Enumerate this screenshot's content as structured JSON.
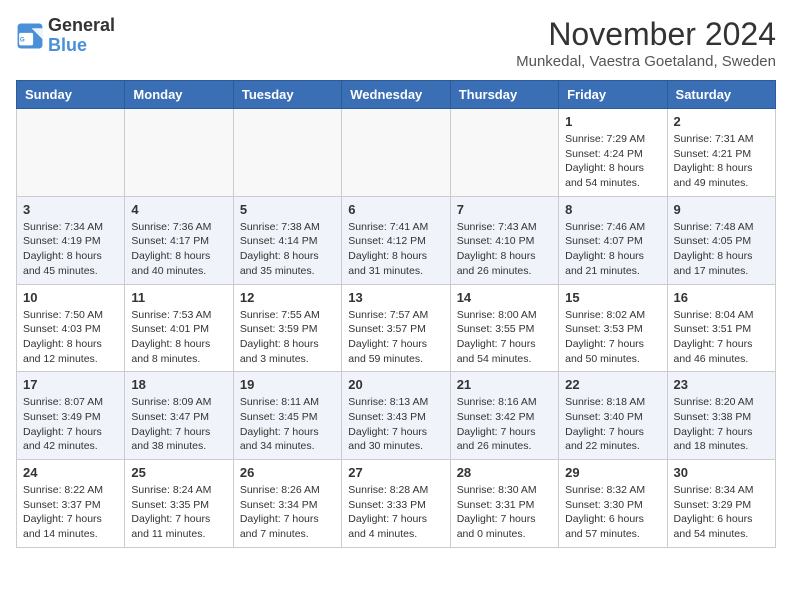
{
  "logo": {
    "line1": "General",
    "line2": "Blue"
  },
  "title": "November 2024",
  "location": "Munkedal, Vaestra Goetaland, Sweden",
  "headers": [
    "Sunday",
    "Monday",
    "Tuesday",
    "Wednesday",
    "Thursday",
    "Friday",
    "Saturday"
  ],
  "weeks": [
    [
      {
        "day": "",
        "content": ""
      },
      {
        "day": "",
        "content": ""
      },
      {
        "day": "",
        "content": ""
      },
      {
        "day": "",
        "content": ""
      },
      {
        "day": "",
        "content": ""
      },
      {
        "day": "1",
        "content": "Sunrise: 7:29 AM\nSunset: 4:24 PM\nDaylight: 8 hours and 54 minutes."
      },
      {
        "day": "2",
        "content": "Sunrise: 7:31 AM\nSunset: 4:21 PM\nDaylight: 8 hours and 49 minutes."
      }
    ],
    [
      {
        "day": "3",
        "content": "Sunrise: 7:34 AM\nSunset: 4:19 PM\nDaylight: 8 hours and 45 minutes."
      },
      {
        "day": "4",
        "content": "Sunrise: 7:36 AM\nSunset: 4:17 PM\nDaylight: 8 hours and 40 minutes."
      },
      {
        "day": "5",
        "content": "Sunrise: 7:38 AM\nSunset: 4:14 PM\nDaylight: 8 hours and 35 minutes."
      },
      {
        "day": "6",
        "content": "Sunrise: 7:41 AM\nSunset: 4:12 PM\nDaylight: 8 hours and 31 minutes."
      },
      {
        "day": "7",
        "content": "Sunrise: 7:43 AM\nSunset: 4:10 PM\nDaylight: 8 hours and 26 minutes."
      },
      {
        "day": "8",
        "content": "Sunrise: 7:46 AM\nSunset: 4:07 PM\nDaylight: 8 hours and 21 minutes."
      },
      {
        "day": "9",
        "content": "Sunrise: 7:48 AM\nSunset: 4:05 PM\nDaylight: 8 hours and 17 minutes."
      }
    ],
    [
      {
        "day": "10",
        "content": "Sunrise: 7:50 AM\nSunset: 4:03 PM\nDaylight: 8 hours and 12 minutes."
      },
      {
        "day": "11",
        "content": "Sunrise: 7:53 AM\nSunset: 4:01 PM\nDaylight: 8 hours and 8 minutes."
      },
      {
        "day": "12",
        "content": "Sunrise: 7:55 AM\nSunset: 3:59 PM\nDaylight: 8 hours and 3 minutes."
      },
      {
        "day": "13",
        "content": "Sunrise: 7:57 AM\nSunset: 3:57 PM\nDaylight: 7 hours and 59 minutes."
      },
      {
        "day": "14",
        "content": "Sunrise: 8:00 AM\nSunset: 3:55 PM\nDaylight: 7 hours and 54 minutes."
      },
      {
        "day": "15",
        "content": "Sunrise: 8:02 AM\nSunset: 3:53 PM\nDaylight: 7 hours and 50 minutes."
      },
      {
        "day": "16",
        "content": "Sunrise: 8:04 AM\nSunset: 3:51 PM\nDaylight: 7 hours and 46 minutes."
      }
    ],
    [
      {
        "day": "17",
        "content": "Sunrise: 8:07 AM\nSunset: 3:49 PM\nDaylight: 7 hours and 42 minutes."
      },
      {
        "day": "18",
        "content": "Sunrise: 8:09 AM\nSunset: 3:47 PM\nDaylight: 7 hours and 38 minutes."
      },
      {
        "day": "19",
        "content": "Sunrise: 8:11 AM\nSunset: 3:45 PM\nDaylight: 7 hours and 34 minutes."
      },
      {
        "day": "20",
        "content": "Sunrise: 8:13 AM\nSunset: 3:43 PM\nDaylight: 7 hours and 30 minutes."
      },
      {
        "day": "21",
        "content": "Sunrise: 8:16 AM\nSunset: 3:42 PM\nDaylight: 7 hours and 26 minutes."
      },
      {
        "day": "22",
        "content": "Sunrise: 8:18 AM\nSunset: 3:40 PM\nDaylight: 7 hours and 22 minutes."
      },
      {
        "day": "23",
        "content": "Sunrise: 8:20 AM\nSunset: 3:38 PM\nDaylight: 7 hours and 18 minutes."
      }
    ],
    [
      {
        "day": "24",
        "content": "Sunrise: 8:22 AM\nSunset: 3:37 PM\nDaylight: 7 hours and 14 minutes."
      },
      {
        "day": "25",
        "content": "Sunrise: 8:24 AM\nSunset: 3:35 PM\nDaylight: 7 hours and 11 minutes."
      },
      {
        "day": "26",
        "content": "Sunrise: 8:26 AM\nSunset: 3:34 PM\nDaylight: 7 hours and 7 minutes."
      },
      {
        "day": "27",
        "content": "Sunrise: 8:28 AM\nSunset: 3:33 PM\nDaylight: 7 hours and 4 minutes."
      },
      {
        "day": "28",
        "content": "Sunrise: 8:30 AM\nSunset: 3:31 PM\nDaylight: 7 hours and 0 minutes."
      },
      {
        "day": "29",
        "content": "Sunrise: 8:32 AM\nSunset: 3:30 PM\nDaylight: 6 hours and 57 minutes."
      },
      {
        "day": "30",
        "content": "Sunrise: 8:34 AM\nSunset: 3:29 PM\nDaylight: 6 hours and 54 minutes."
      }
    ]
  ]
}
